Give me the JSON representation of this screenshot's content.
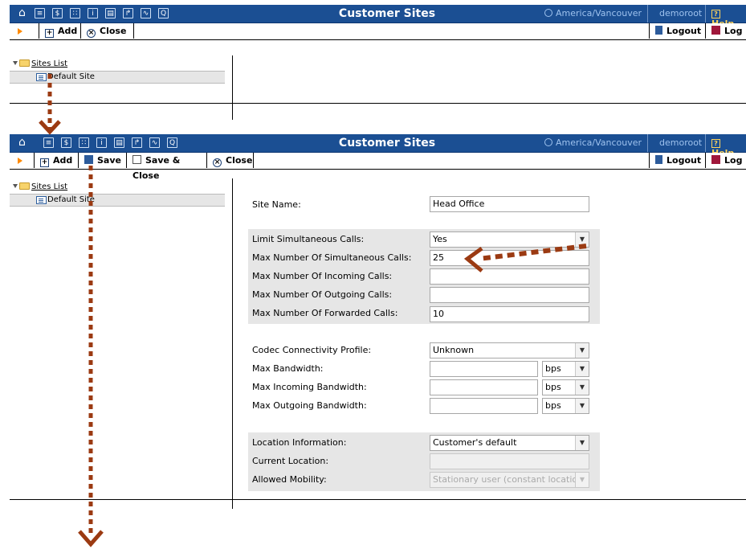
{
  "top_window": {
    "title": "Customer Sites",
    "timezone": "America/Vancouver",
    "user": "demoroot",
    "help": "Help",
    "toolbar": {
      "add": "Add",
      "close": "Close",
      "logout": "Logout",
      "log": "Log"
    },
    "tree": {
      "root": "Sites List",
      "item": "Default Site"
    }
  },
  "bottom_window": {
    "title": "Customer Sites",
    "timezone": "America/Vancouver",
    "user": "demoroot",
    "help": "Help",
    "toolbar": {
      "add": "Add",
      "save": "Save",
      "save_close": "Save & Close",
      "close": "Close",
      "logout": "Logout",
      "log": "Log"
    },
    "tree": {
      "root": "Sites List",
      "item": "Default Site"
    },
    "form": {
      "site_name_label": "Site Name:",
      "site_name_value": "Head Office",
      "limit_calls_label": "Limit Simultaneous Calls:",
      "limit_calls_value": "Yes",
      "max_simul_label": "Max Number Of Simultaneous Calls:",
      "max_simul_value": "25",
      "max_incoming_label": "Max Number Of Incoming Calls:",
      "max_incoming_value": "",
      "max_outgoing_label": "Max Number Of Outgoing Calls:",
      "max_outgoing_value": "",
      "max_forwarded_label": "Max Number Of Forwarded Calls:",
      "max_forwarded_value": "10",
      "codec_label": "Codec Connectivity Profile:",
      "codec_value": "Unknown",
      "max_bw_label": "Max Bandwidth:",
      "max_bw_unit": "bps",
      "max_in_bw_label": "Max Incoming Bandwidth:",
      "max_in_bw_unit": "bps",
      "max_out_bw_label": "Max Outgoing Bandwidth:",
      "max_out_bw_unit": "bps",
      "location_label": "Location Information:",
      "location_value": "Customer's default",
      "current_location_label": "Current Location:",
      "current_location_value": "",
      "mobility_label": "Allowed Mobility:",
      "mobility_value": "Stationary user (constant location)"
    }
  },
  "colors": {
    "titlebar": "#1b4f93",
    "accent": "#ff8a00",
    "annotation": "#9b3a12",
    "group_bg": "#e6e6e6"
  },
  "icons": [
    "home-icon",
    "list-icon",
    "dollar-icon",
    "grid-icon",
    "person-icon",
    "columns-icon",
    "exit-icon",
    "chart-icon",
    "search-icon",
    "clock-icon",
    "help-icon",
    "add-icon",
    "close-icon",
    "save-icon",
    "logout-icon",
    "log-icon",
    "folder-icon",
    "site-icon",
    "dropdown-arrow-icon"
  ]
}
